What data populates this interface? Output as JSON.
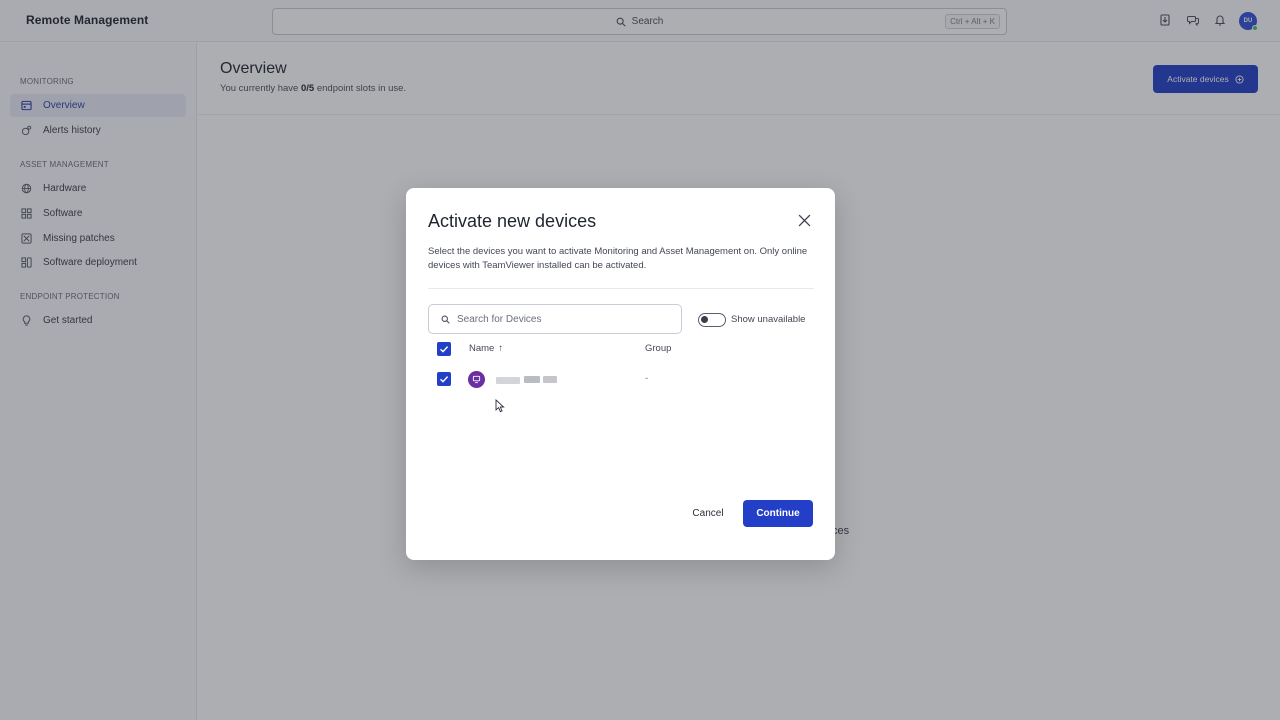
{
  "app": {
    "title": "Remote Management"
  },
  "search": {
    "placeholder": "Search",
    "shortcut": "Ctrl + Alt + K"
  },
  "user": {
    "initials": "DU"
  },
  "sidebar": {
    "sections": [
      {
        "label": "MONITORING",
        "items": [
          {
            "label": "Overview",
            "active": true
          },
          {
            "label": "Alerts history"
          }
        ]
      },
      {
        "label": "ASSET MANAGEMENT",
        "items": [
          {
            "label": "Hardware"
          },
          {
            "label": "Software"
          },
          {
            "label": "Missing patches"
          },
          {
            "label": "Software deployment"
          }
        ]
      },
      {
        "label": "ENDPOINT PROTECTION",
        "items": [
          {
            "label": "Get started"
          }
        ]
      }
    ]
  },
  "page": {
    "title": "Overview",
    "subtitle_prefix": "You currently have ",
    "slots": "0/5",
    "subtitle_suffix": " endpoint slots in use.",
    "activate_button": "Activate devices",
    "background_fragment": "ces"
  },
  "modal": {
    "title": "Activate new devices",
    "description": "Select the devices you want to activate Monitoring and Asset Management on. Only online devices with TeamViewer installed can be activated.",
    "search_placeholder": "Search for Devices",
    "toggle_label": "Show unavailable",
    "toggle_on": false,
    "columns": {
      "name": "Name",
      "sort_indicator": "↑",
      "group": "Group"
    },
    "rows": [
      {
        "selected": true,
        "group": "-"
      }
    ],
    "cancel_label": "Cancel",
    "continue_label": "Continue"
  },
  "colors": {
    "accent": "#233fc8",
    "device_icon": "#6b2fa3",
    "online": "#3ec46d"
  }
}
